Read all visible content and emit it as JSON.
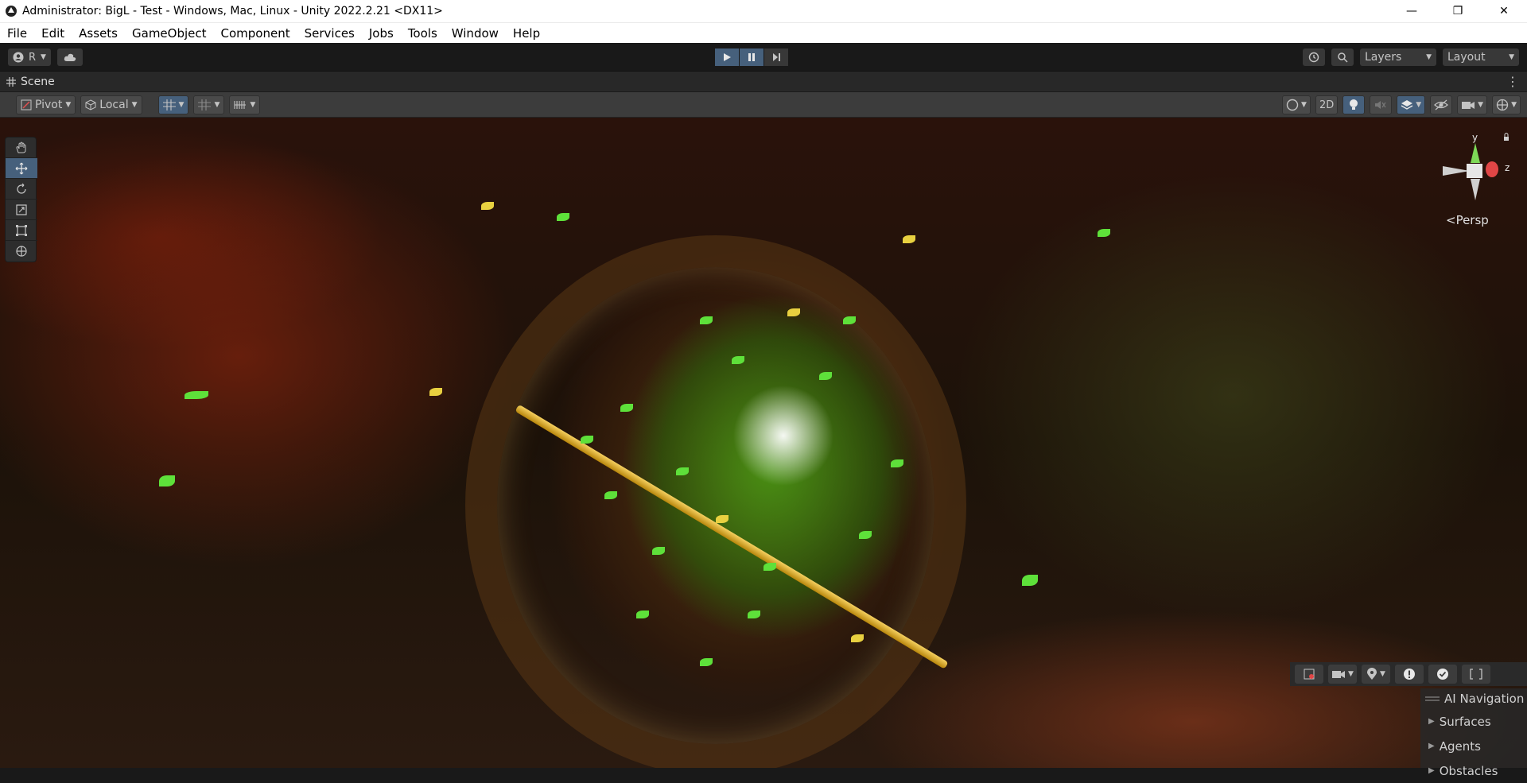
{
  "window": {
    "title": "Administrator: BigL - Test - Windows, Mac, Linux - Unity 2022.2.21 <DX11>",
    "minimize": "—",
    "maximize": "❐",
    "close": "✕"
  },
  "menu": [
    "File",
    "Edit",
    "Assets",
    "GameObject",
    "Component",
    "Services",
    "Jobs",
    "Tools",
    "Window",
    "Help"
  ],
  "toolbar": {
    "account_label": "R",
    "layers_label": "Layers",
    "layout_label": "Layout"
  },
  "scene_tab": {
    "label": "Scene"
  },
  "scene_tools": {
    "pivot_label": "Pivot",
    "local_label": "Local",
    "mode_2d_label": "2D"
  },
  "gizmo": {
    "y_label": "y",
    "z_label": "z",
    "projection_label": "<Persp"
  },
  "ai_navigation": {
    "title": "AI Navigation",
    "items": [
      "Surfaces",
      "Agents",
      "Obstacles"
    ]
  }
}
